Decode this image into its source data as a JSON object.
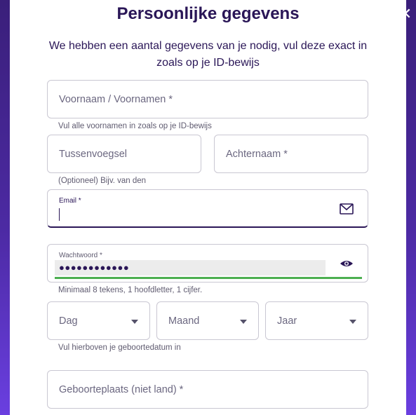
{
  "header": {
    "title": "Persoonlijke gegevens",
    "subtitle": "We hebben een aantal gegevens van je nodig, vul deze exact in zoals op je ID-bewijs"
  },
  "form": {
    "firstnames": {
      "placeholder": "Voornaam / Voornamen *",
      "hint": "Vul alle voornamen in zoals op je ID-bewijs"
    },
    "tussenvoegsel": {
      "placeholder": "Tussenvoegsel",
      "hint": "(Optioneel) Bijv. van den"
    },
    "achternaam": {
      "placeholder": "Achternaam *"
    },
    "email": {
      "label": "Email *",
      "value": "",
      "icon": "envelope-icon"
    },
    "password": {
      "label": "Wachtwoord *",
      "masked_value": "●●●●●●●●●●●●",
      "icon": "eye-icon",
      "hint": "Minimaal 8 tekens, 1 hoofdletter, 1 cijfer."
    },
    "birthdate": {
      "day": "Dag",
      "month": "Maand",
      "year": "Jaar",
      "hint": "Vul hierboven je geboortedatum in"
    },
    "birthplace": {
      "placeholder": "Geboorteplaats (niet land) *"
    }
  },
  "colors": {
    "title": "#2a1657",
    "strength_bar": "#4caf50",
    "focus_border": "#2a1657"
  },
  "close_icon": "close-icon"
}
